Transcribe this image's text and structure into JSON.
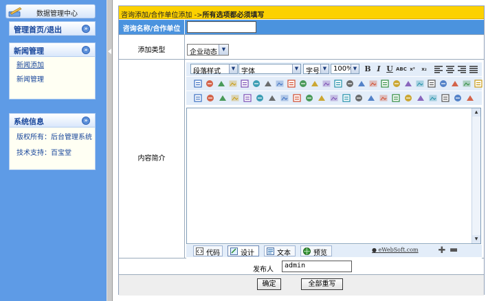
{
  "sidebar": {
    "title": "数据管理中心",
    "groups": [
      {
        "label": "管理首页/退出",
        "items": []
      },
      {
        "label": "新闻管理",
        "items": [
          "新闻添加",
          "新闻管理"
        ]
      },
      {
        "label": "系统信息",
        "items": [
          "版权所有：后台管理系统",
          "技术支持：百宝堂"
        ]
      }
    ]
  },
  "form": {
    "breadcrumb": "咨询添加/合作单位添加 ->",
    "notice": "所有选项都必须填写",
    "name_label": "咨询名称/合作单位",
    "name_value": "",
    "type_label": "添加类型",
    "type_value": "企业动态",
    "content_label": "内容简介",
    "author_label": "发布人",
    "author_value": "admin",
    "ok_label": "确定",
    "reset_label": "全部重写"
  },
  "editor": {
    "paragraph_style": "段落样式",
    "font": "字体",
    "font_size": "字号",
    "zoom": "100%",
    "format_buttons": [
      "B",
      "I",
      "U",
      "ABC",
      "x²",
      "x₂"
    ],
    "modes": [
      "代码",
      "设计",
      "文本",
      "预览"
    ],
    "active_mode": "设计",
    "credit": "eWebSoft.com",
    "icons": {
      "row2": [
        "cut-icon",
        "copy-icon",
        "paste-icon",
        "paste-text-icon",
        "paste-word-icon",
        "find-icon",
        "delete-icon",
        "eraser-icon",
        "undo-icon",
        "redo-icon",
        "select-all-icon",
        "unselect-icon",
        "ordered-list-icon",
        "unordered-list-icon",
        "outdent-icon",
        "indent-icon",
        "font-color-icon",
        "bg-color-icon",
        "format-brush-icon",
        "remove-format-icon",
        "table-icon",
        "insert-row-icon",
        "insert-image-icon",
        "about-icon",
        "help-icon"
      ],
      "row3": [
        "image-icon",
        "flash-icon",
        "media-icon",
        "file-icon",
        "line-icon",
        "textbox-icon",
        "marquee-icon",
        "special-char-icon",
        "date-icon",
        "time-icon",
        "excel-icon",
        "link-icon",
        "unlink-icon",
        "anchor-icon",
        "smiley-icon",
        "emoticon-icon",
        "calc-icon",
        "print-icon",
        "frame-icon",
        "page-break-icon",
        "fullscreen-icon",
        "help-box-icon",
        "info-icon"
      ]
    }
  }
}
